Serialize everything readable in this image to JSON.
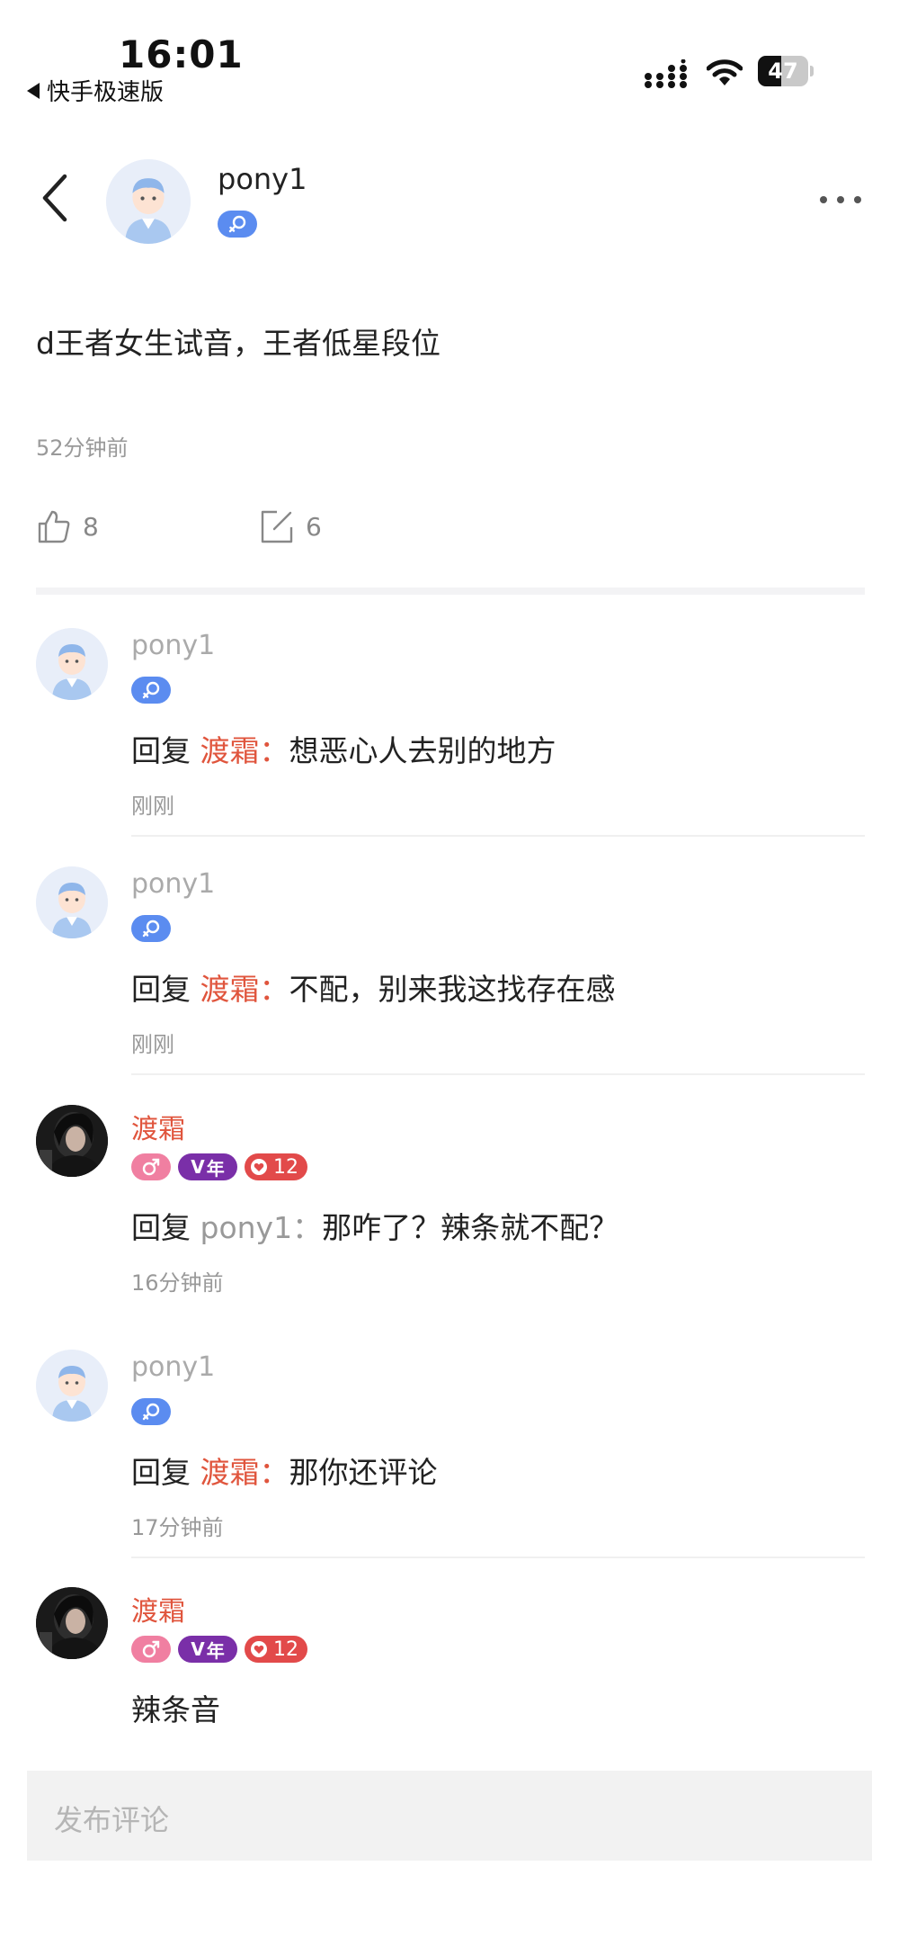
{
  "status_bar": {
    "time": "16:01",
    "back_app_label": "快手极速版",
    "battery_level": "47",
    "battery_fraction": 0.47
  },
  "header": {
    "username": "pony1",
    "gender_badge": "female-symbol-icon",
    "menu_icon": "more-icon"
  },
  "post": {
    "text": "d王者女生试音，王者低星段位",
    "time": "52分钟前",
    "like_count": "8",
    "comment_count": "6"
  },
  "comments": [
    {
      "name": "pony1",
      "reply_prefix": "回复",
      "reply_target": "渡霜",
      "reply_sep": "：",
      "text": "想恶心人去别的地方",
      "time": "刚刚"
    },
    {
      "name": "pony1",
      "reply_prefix": "回复",
      "reply_target": "渡霜",
      "reply_sep": "：",
      "text": "不配，别来我这找存在感",
      "time": "刚刚"
    },
    {
      "name": "渡霜",
      "vip_label": "年",
      "fans_level": "12",
      "reply_prefix": "回复",
      "reply_target": "pony1",
      "reply_sep": "：",
      "text": "那咋了？辣条就不配？",
      "time": "16分钟前"
    },
    {
      "name": "pony1",
      "reply_prefix": "回复",
      "reply_target": "渡霜",
      "reply_sep": "：",
      "text": "那你还评论",
      "time": "17分钟前"
    },
    {
      "name": "渡霜",
      "vip_label": "年",
      "fans_level": "12",
      "text": "辣条音"
    }
  ],
  "input": {
    "placeholder": "发布评论"
  },
  "colors": {
    "accent_red": "#e0553d",
    "female_badge": "#5b8cf0",
    "male_badge": "#f07fa1",
    "vip_badge": "#7a2fa8",
    "fans_badge": "#e24a4a"
  }
}
